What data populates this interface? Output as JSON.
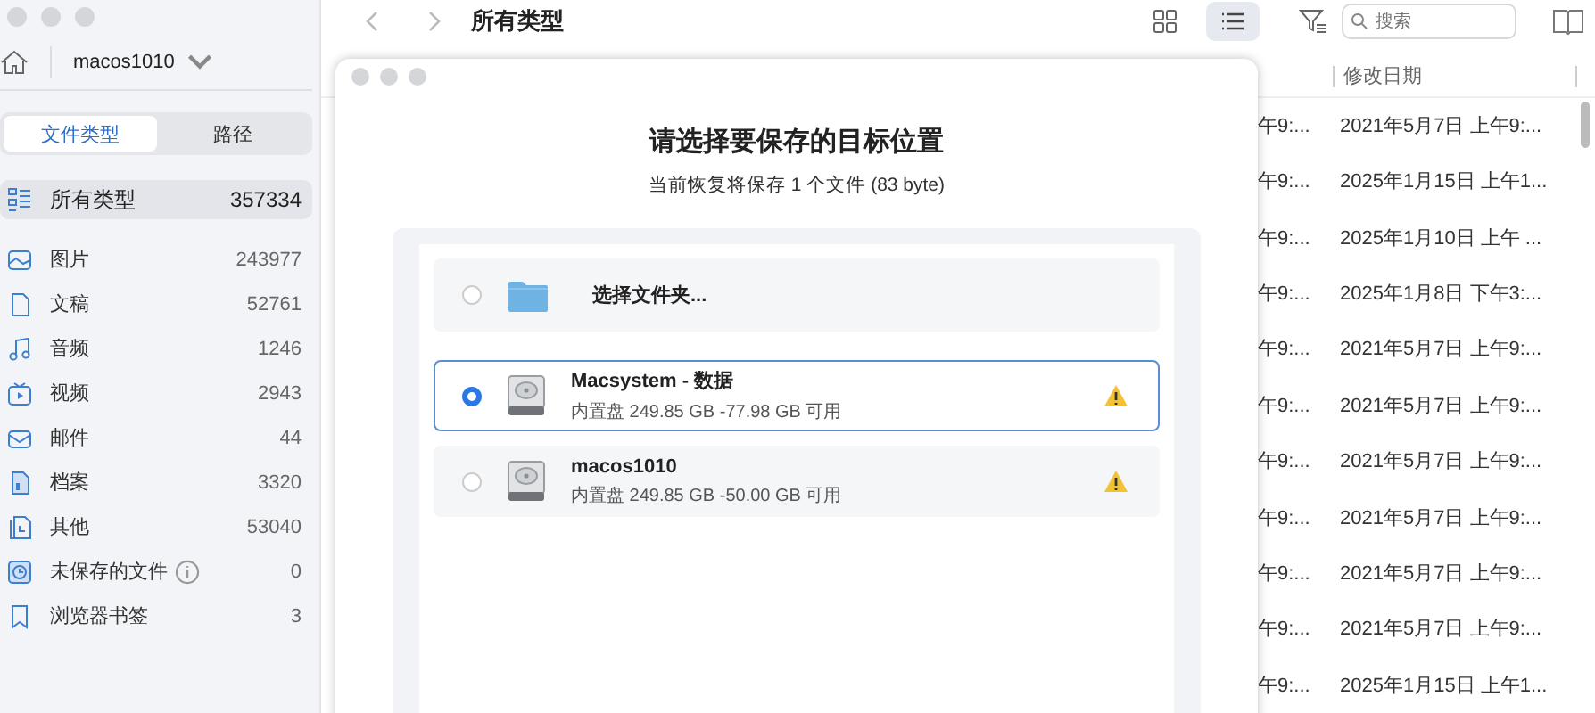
{
  "sidebar": {
    "location": "macos1010",
    "tabs": [
      {
        "label": "文件类型",
        "selected": true
      },
      {
        "label": "路径",
        "selected": false
      }
    ],
    "items": [
      {
        "label": "所有类型",
        "count": "357334",
        "selected": true,
        "info": false
      },
      {
        "label": "图片",
        "count": "243977",
        "selected": false,
        "info": false
      },
      {
        "label": "文稿",
        "count": "52761",
        "selected": false,
        "info": false
      },
      {
        "label": "音频",
        "count": "1246",
        "selected": false,
        "info": false
      },
      {
        "label": "视频",
        "count": "2943",
        "selected": false,
        "info": false
      },
      {
        "label": "邮件",
        "count": "44",
        "selected": false,
        "info": false
      },
      {
        "label": "档案",
        "count": "3320",
        "selected": false,
        "info": false
      },
      {
        "label": "其他",
        "count": "53040",
        "selected": false,
        "info": false
      },
      {
        "label": "未保存的文件",
        "count": "0",
        "selected": false,
        "info": true
      },
      {
        "label": "浏览器书签",
        "count": "3",
        "selected": false,
        "info": false
      }
    ]
  },
  "toolbar": {
    "title": "所有类型",
    "views": [
      {
        "kind": "grid",
        "selected": false
      },
      {
        "kind": "list",
        "selected": true
      }
    ],
    "search": {
      "placeholder": "搜索"
    }
  },
  "table": {
    "columns": [
      "修改日期"
    ],
    "rows": [
      {
        "column_1": "午9:...",
        "date": "2021年5月7日 上午9:..."
      },
      {
        "column_1": "午9:...",
        "date": "2025年1月15日 上午1..."
      },
      {
        "column_1": "午9:...",
        "date": "2025年1月10日 上午 ..."
      },
      {
        "column_1": "午9:...",
        "date": "2025年1月8日 下午3:..."
      },
      {
        "column_1": "午9:...",
        "date": "2021年5月7日 上午9:..."
      },
      {
        "column_1": "午9:...",
        "date": "2021年5月7日 上午9:..."
      },
      {
        "column_1": "午9:...",
        "date": "2021年5月7日 上午9:..."
      },
      {
        "column_1": "午9:...",
        "date": "2021年5月7日 上午9:..."
      },
      {
        "column_1": "午9:...",
        "date": "2021年5月7日 上午9:..."
      },
      {
        "column_1": "午9:...",
        "date": "2021年5月7日 上午9:..."
      },
      {
        "column_1": "午9:...",
        "date": "2025年1月15日 上午1..."
      }
    ]
  },
  "dialog": {
    "title": "请选择要保存的目标位置",
    "subtitle": "当前恢复将保存 1 个文件 (83 byte)",
    "options": [
      {
        "kind": "folder",
        "label": "选择文件夹...",
        "selected": false
      },
      {
        "kind": "drive",
        "name": "Macsystem - 数据",
        "detail": "内置盘 249.85 GB -77.98 GB 可用",
        "selected": true,
        "warning": true
      },
      {
        "kind": "drive",
        "name": "macos1010",
        "detail": "内置盘 249.85 GB -50.00 GB 可用",
        "selected": false,
        "warning": true
      }
    ]
  }
}
